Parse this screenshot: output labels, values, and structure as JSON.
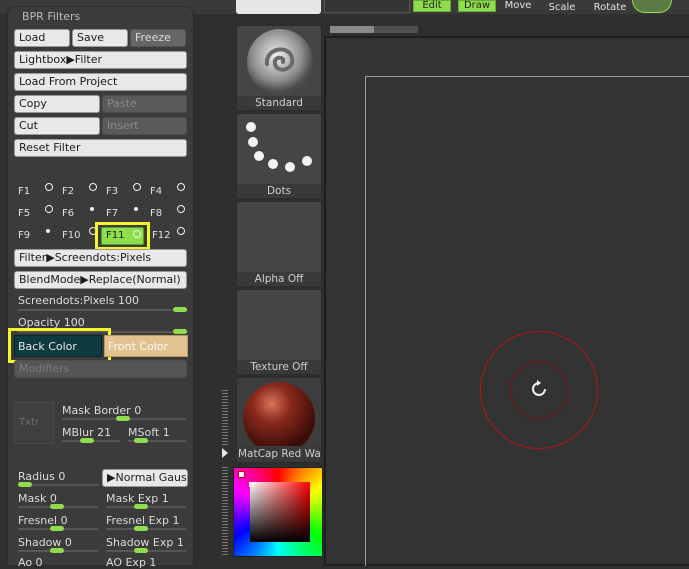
{
  "panel": {
    "title": "BPR Filters",
    "load": "Load",
    "save": "Save",
    "freeze": "Freeze",
    "lightbox": "Lightbox▶Filter",
    "load_from_project": "Load From Project",
    "copy": "Copy",
    "paste": "Paste",
    "cut": "Cut",
    "insert": "Insert",
    "reset_filter": "Reset Filter",
    "slots": [
      "F1",
      "F2",
      "F3",
      "F4",
      "F5",
      "F6",
      "F7",
      "F8",
      "F9",
      "F10",
      "F11",
      "F12"
    ],
    "selected_slot": "F11",
    "filter": "Filter▶Screendots:Pixels",
    "blendmode": "BlendMode▶Replace(Normal)",
    "screendots_label": "Screendots:Pixels 100",
    "opacity_label": "Opacity 100",
    "back_color": "Back Color",
    "front_color": "Front Color",
    "modifiers": "Modifiers",
    "txtr": "Txtr",
    "mask_border": "Mask Border 0",
    "mblur": "MBlur 21",
    "msoft": "MSoft 1",
    "radius": "Radius 0",
    "normal_gauss": "▶Normal Gauss",
    "mask": "Mask 0",
    "mask_exp": "Mask Exp 1",
    "fresnel": "Fresnel 0",
    "fresnel_exp": "Fresnel Exp 1",
    "shadow": "Shadow 0",
    "shadow_exp": "Shadow Exp 1",
    "ao_partial": "Ao 0",
    "ao_exp_partial": "AO Exp 1"
  },
  "materials": {
    "standard": "Standard",
    "dots": "Dots",
    "alpha_off": "Alpha Off",
    "texture_off": "Texture Off",
    "matcap": "MatCap Red Wax"
  },
  "toolbar": {
    "edit": "Edit",
    "draw": "Draw",
    "move": "Move",
    "scale": "Scale",
    "rotate": "Rotate"
  },
  "colors": {
    "accent_green": "#8ede4c",
    "highlight_yellow": "#f5f52a",
    "back_color_swatch": "#0d3b3f",
    "front_color_swatch": "#e2c28f",
    "brush_ring": "#b01818"
  }
}
